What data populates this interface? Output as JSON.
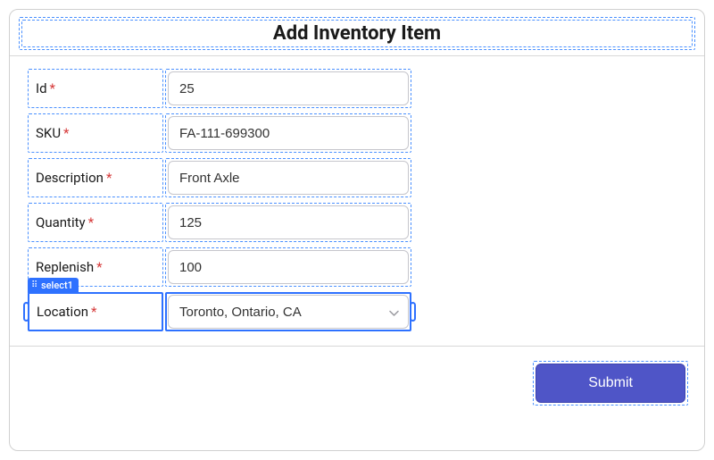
{
  "title": "Add Inventory Item",
  "selection_tag": "select1",
  "fields": {
    "id": {
      "label": "Id",
      "value": "25"
    },
    "sku": {
      "label": "SKU",
      "value": "FA-111-699300"
    },
    "description": {
      "label": "Description",
      "value": "Front Axle"
    },
    "quantity": {
      "label": "Quantity",
      "value": "125"
    },
    "replenish": {
      "label": "Replenish",
      "value": "100"
    },
    "location": {
      "label": "Location",
      "value": "Toronto, Ontario, CA"
    }
  },
  "submit_label": "Submit",
  "required_marker": "*"
}
